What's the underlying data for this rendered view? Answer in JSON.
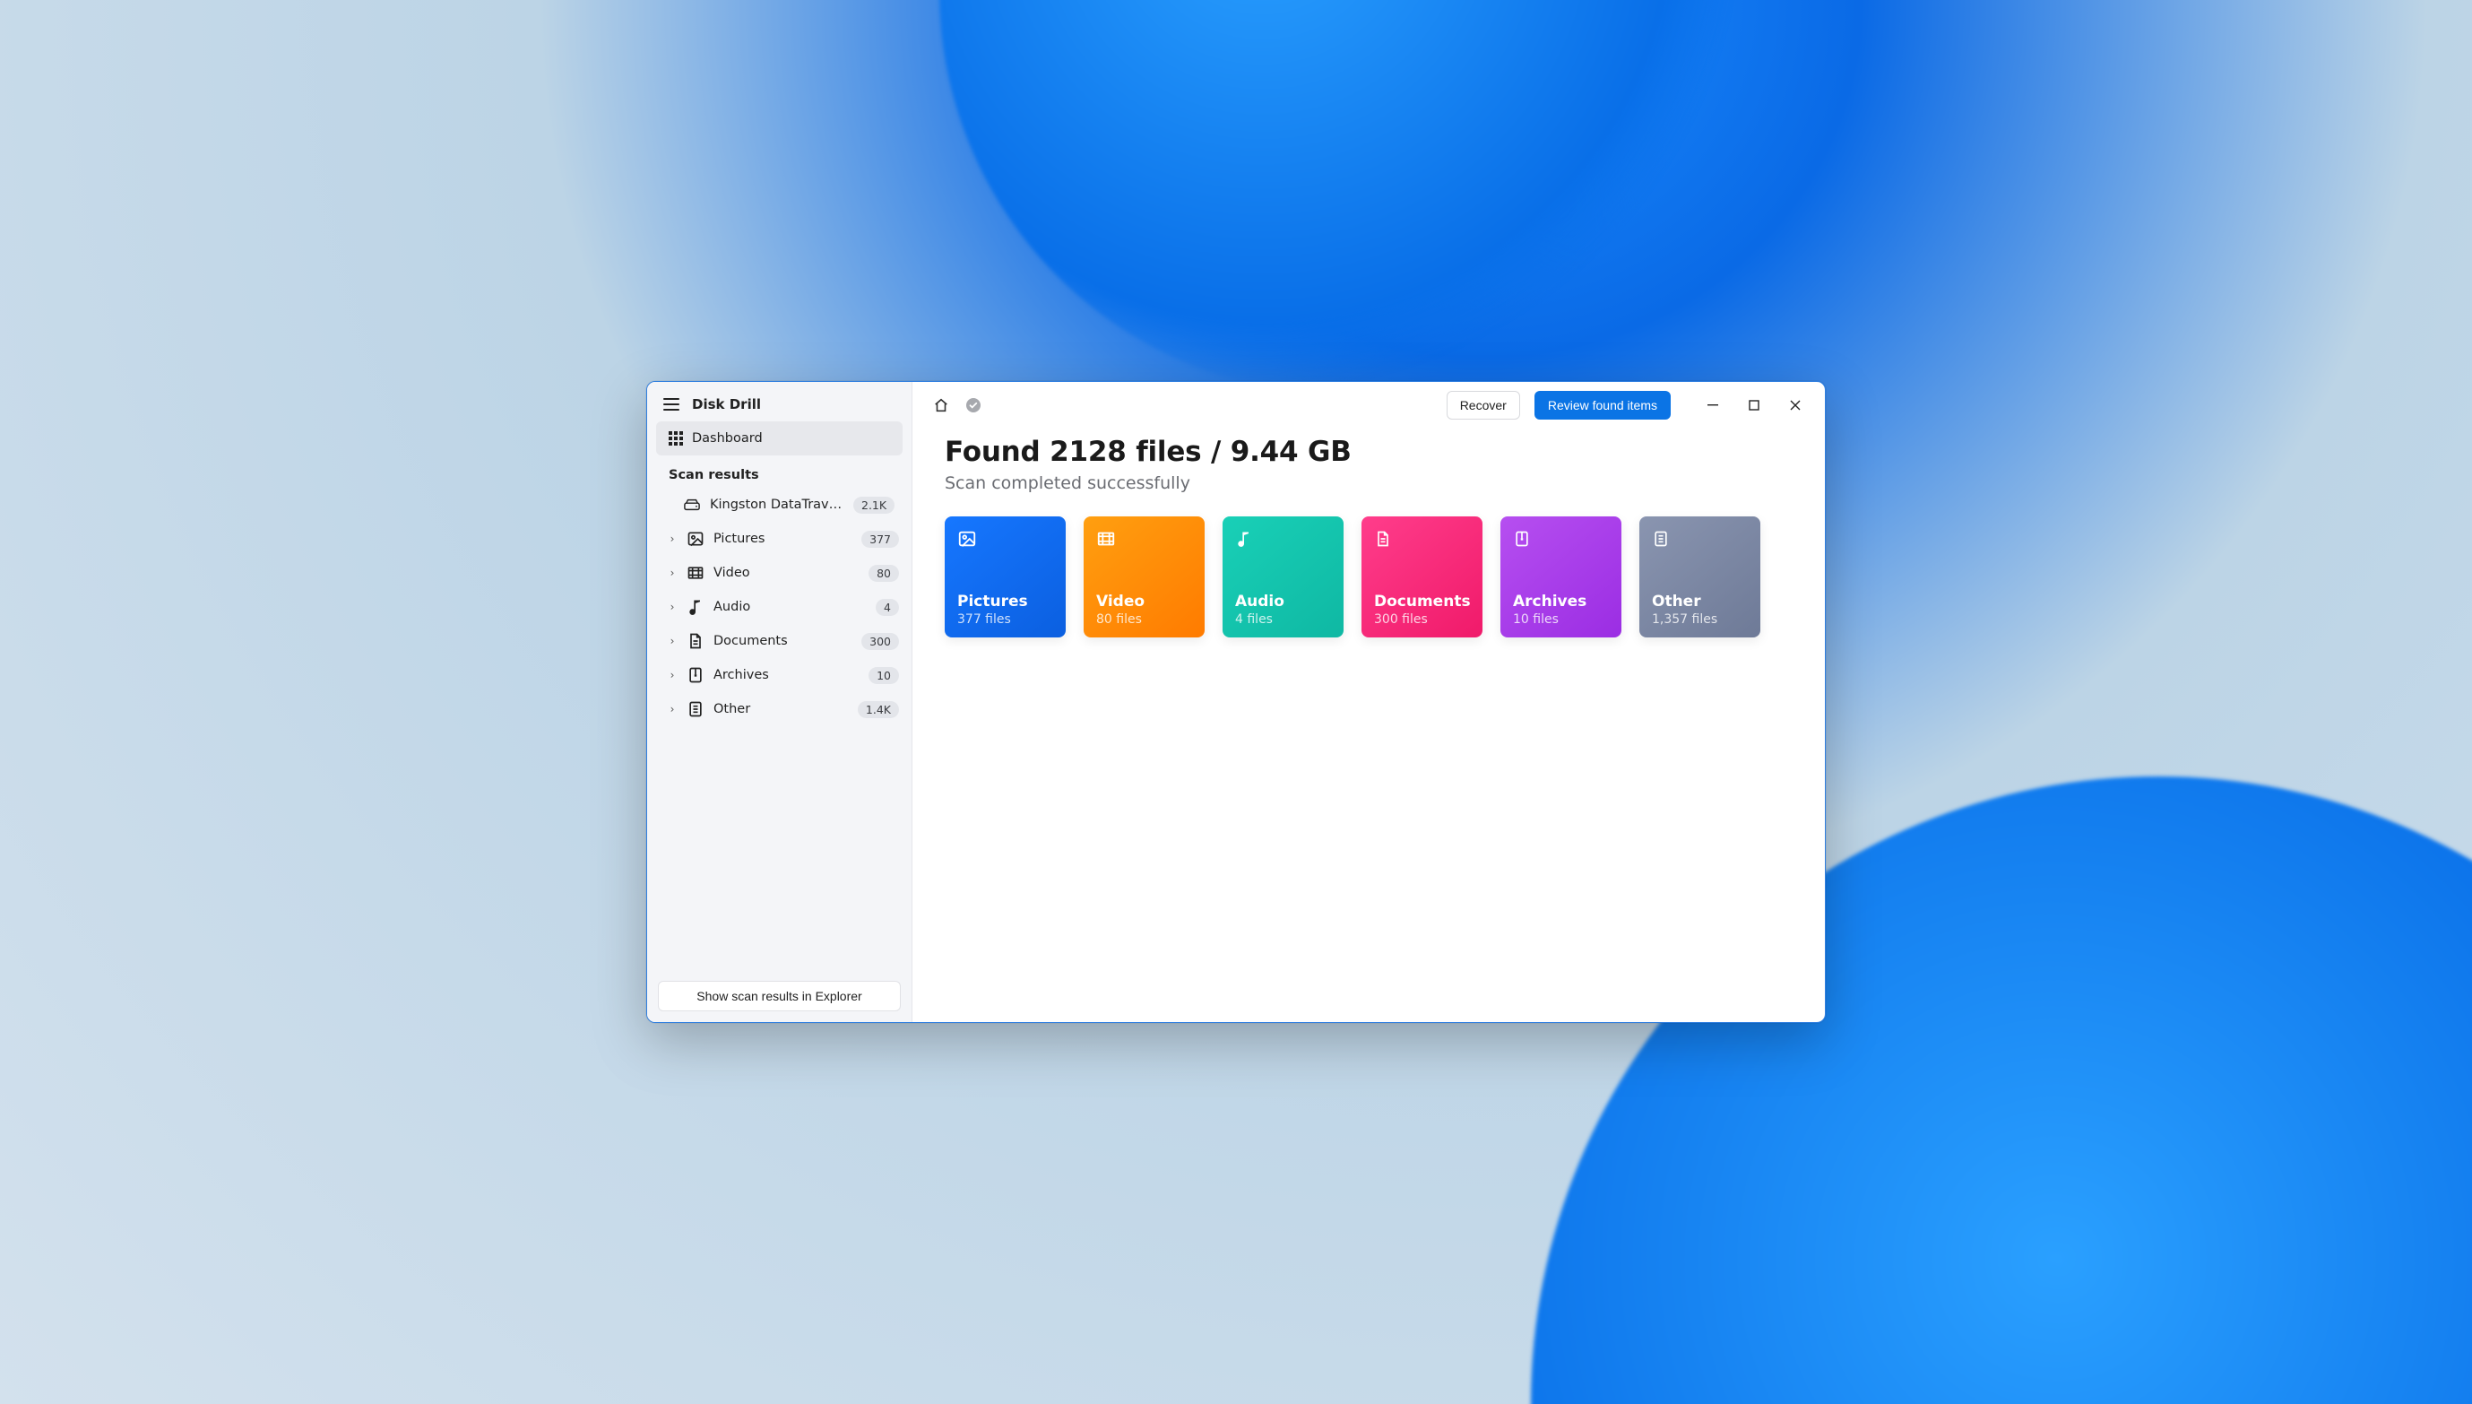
{
  "app_title": "Disk Drill",
  "sidebar": {
    "dashboard_label": "Dashboard",
    "section_label": "Scan results",
    "device": {
      "label": "Kingston DataTraveler E…",
      "count": "2.1K"
    },
    "items": [
      {
        "key": "pictures",
        "label": "Pictures",
        "count": "377"
      },
      {
        "key": "video",
        "label": "Video",
        "count": "80"
      },
      {
        "key": "audio",
        "label": "Audio",
        "count": "4"
      },
      {
        "key": "documents",
        "label": "Documents",
        "count": "300"
      },
      {
        "key": "archives",
        "label": "Archives",
        "count": "10"
      },
      {
        "key": "other",
        "label": "Other",
        "count": "1.4K"
      }
    ],
    "footer_button": "Show scan results in Explorer"
  },
  "toolbar": {
    "recover_label": "Recover",
    "review_label": "Review found items"
  },
  "main": {
    "heading": "Found 2128 files / 9.44 GB",
    "subtitle": "Scan completed successfully",
    "cards": [
      {
        "key": "pictures",
        "title": "Pictures",
        "sub": "377 files"
      },
      {
        "key": "video",
        "title": "Video",
        "sub": "80 files"
      },
      {
        "key": "audio",
        "title": "Audio",
        "sub": "4 files"
      },
      {
        "key": "documents",
        "title": "Documents",
        "sub": "300 files"
      },
      {
        "key": "archives",
        "title": "Archives",
        "sub": "10 files"
      },
      {
        "key": "other",
        "title": "Other",
        "sub": "1,357 files"
      }
    ]
  }
}
